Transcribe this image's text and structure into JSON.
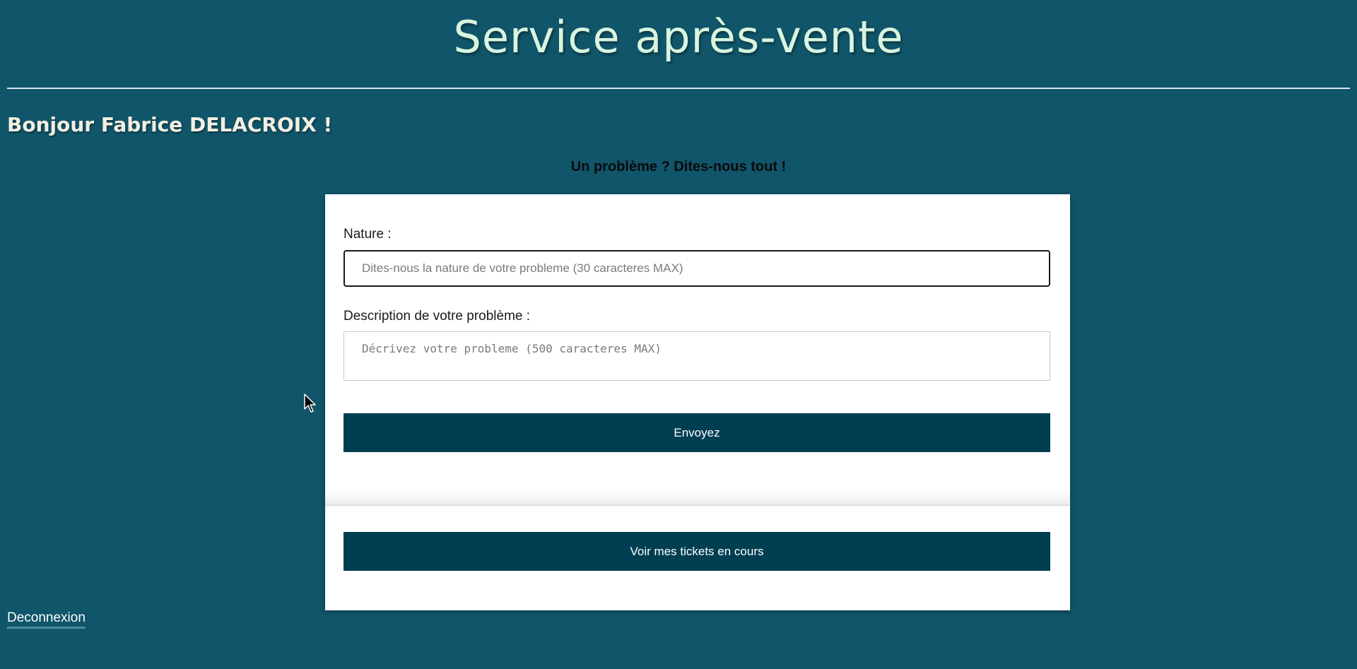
{
  "header": {
    "title": "Service après-vente"
  },
  "greeting": "Bonjour Fabrice DELACROIX !",
  "subtitle": "Un problème ? Dites-nous tout !",
  "form": {
    "nature_label": "Nature :",
    "nature_placeholder": "Dites-nous la nature de votre probleme (30 caracteres MAX)",
    "nature_value": "",
    "description_label": "Description de votre problème :",
    "description_placeholder": "Décrivez votre probleme (500 caracteres MAX)",
    "description_value": "",
    "submit_label": "Envoyez"
  },
  "tickets_button_label": "Voir mes tickets en cours",
  "logout_label": "Deconnexion",
  "colors": {
    "background": "#10556a",
    "button": "#003e52",
    "title": "#d9f5df",
    "card": "#ffffff"
  },
  "icons": {
    "cursor": "mouse-pointer-icon"
  }
}
